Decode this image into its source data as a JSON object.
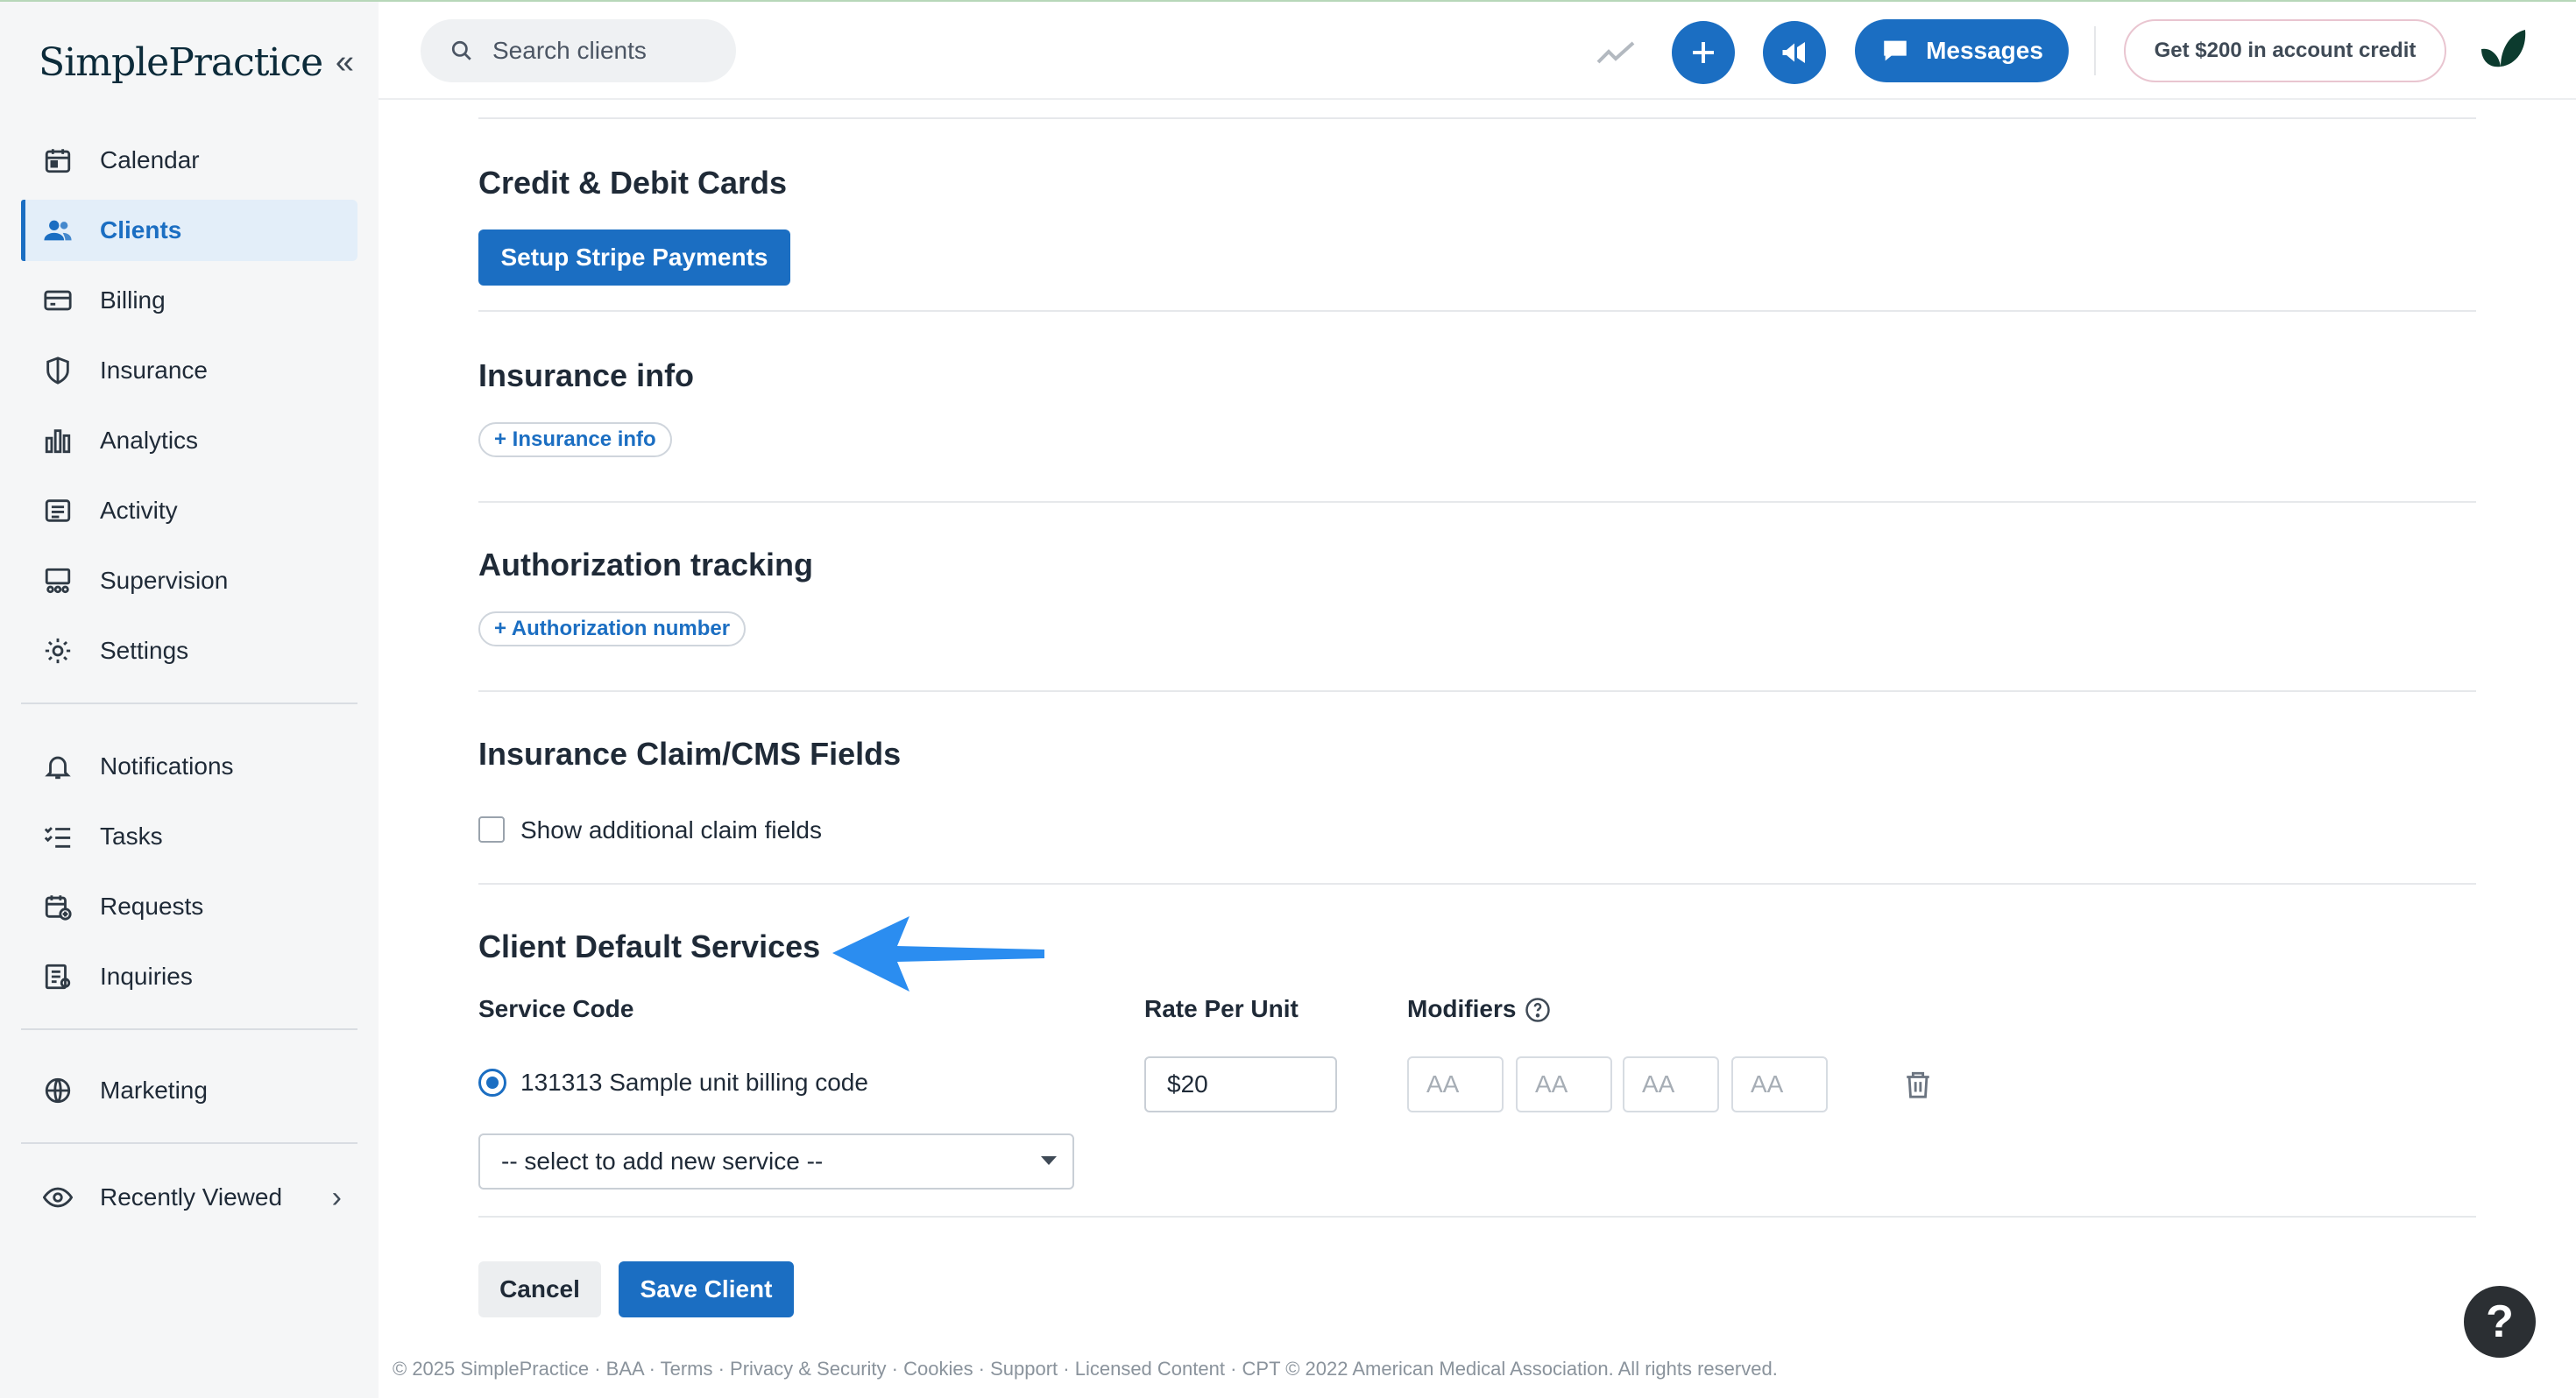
{
  "app": {
    "logo_text": "SimplePractice",
    "accent_color": "#1b6ec2"
  },
  "sidebar": {
    "items": [
      {
        "label": "Calendar",
        "icon": "calendar-icon"
      },
      {
        "label": "Clients",
        "icon": "clients-icon",
        "active": true
      },
      {
        "label": "Billing",
        "icon": "billing-card-icon"
      },
      {
        "label": "Insurance",
        "icon": "shield-icon"
      },
      {
        "label": "Analytics",
        "icon": "bar-chart-icon"
      },
      {
        "label": "Activity",
        "icon": "activity-list-icon"
      },
      {
        "label": "Supervision",
        "icon": "supervision-icon"
      },
      {
        "label": "Settings",
        "icon": "gear-icon"
      }
    ],
    "secondary_items": [
      {
        "label": "Notifications",
        "icon": "bell-icon"
      },
      {
        "label": "Tasks",
        "icon": "tasks-checklist-icon"
      },
      {
        "label": "Requests",
        "icon": "calendar-request-icon"
      },
      {
        "label": "Inquiries",
        "icon": "inquiries-icon"
      }
    ],
    "marketing": {
      "label": "Marketing",
      "icon": "globe-icon"
    },
    "recently_viewed": {
      "label": "Recently Viewed",
      "icon": "eye-icon"
    }
  },
  "topbar": {
    "search_placeholder": "Search clients",
    "messages_label": "Messages",
    "credit_label": "Get $200 in account credit"
  },
  "sections": {
    "cards": {
      "title": "Credit & Debit Cards",
      "button": "Setup Stripe Payments"
    },
    "insurance": {
      "title": "Insurance info",
      "link": "+ Insurance info"
    },
    "authorization": {
      "title": "Authorization tracking",
      "link": "+ Authorization number"
    },
    "claim": {
      "title": "Insurance Claim/CMS Fields",
      "checkbox_label": "Show additional claim fields"
    },
    "services": {
      "title": "Client Default Services",
      "col_service": "Service Code",
      "col_rate": "Rate Per Unit",
      "col_modifiers": "Modifiers",
      "row_service": "131313 Sample unit billing code",
      "row_rate": "$20",
      "modifier_placeholder": "AA",
      "select_placeholder": "-- select to add new service --"
    }
  },
  "actions": {
    "cancel": "Cancel",
    "save": "Save Client"
  },
  "footer": "© 2025 SimplePractice · BAA · Terms · Privacy & Security · Cookies · Support · Licensed Content · CPT © 2022 American Medical Association. All rights reserved.",
  "help_label": "?"
}
